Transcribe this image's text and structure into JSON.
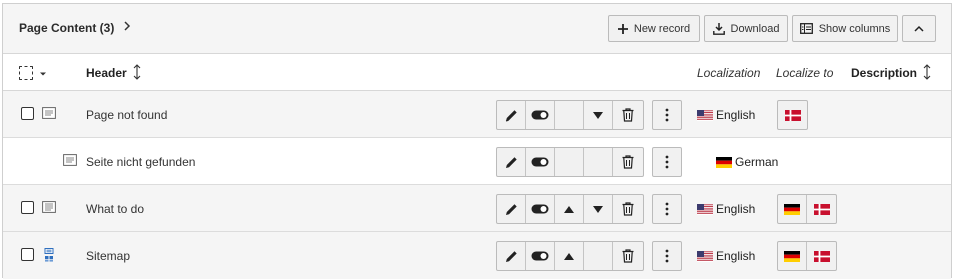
{
  "header": {
    "title": "Page Content (3)",
    "buttons": {
      "new_record": "New record",
      "download": "Download",
      "show_columns": "Show columns"
    }
  },
  "columns": {
    "header": "Header",
    "localization": "Localization",
    "localize_to": "Localize to",
    "description": "Description"
  },
  "rows": [
    {
      "label": "Page not found",
      "language": "English",
      "localize_to": [
        "Danish"
      ]
    },
    {
      "label": "Seite nicht gefunden",
      "language": "German",
      "localize_to": []
    },
    {
      "label": "What to do",
      "language": "English",
      "localize_to": [
        "German",
        "Danish"
      ]
    },
    {
      "label": "Sitemap",
      "language": "English",
      "localize_to": [
        "German",
        "Danish"
      ]
    }
  ],
  "icons": {
    "title_chevron": "chevron-right-icon",
    "new_record": "plus-icon",
    "download": "download-icon",
    "show_columns": "columns-icon",
    "collapse": "chevron-up-icon",
    "edit": "pencil-icon",
    "toggle": "toggle-icon",
    "delete": "trash-icon",
    "more": "dots-vertical-icon"
  },
  "colors": {
    "header_bg": "#f5f5f5",
    "row_shaded": "#f5f5f5",
    "border": "#cfcfcf",
    "button_bg": "#f1f1f1",
    "sitemap_icon": "#2f6fbe"
  }
}
